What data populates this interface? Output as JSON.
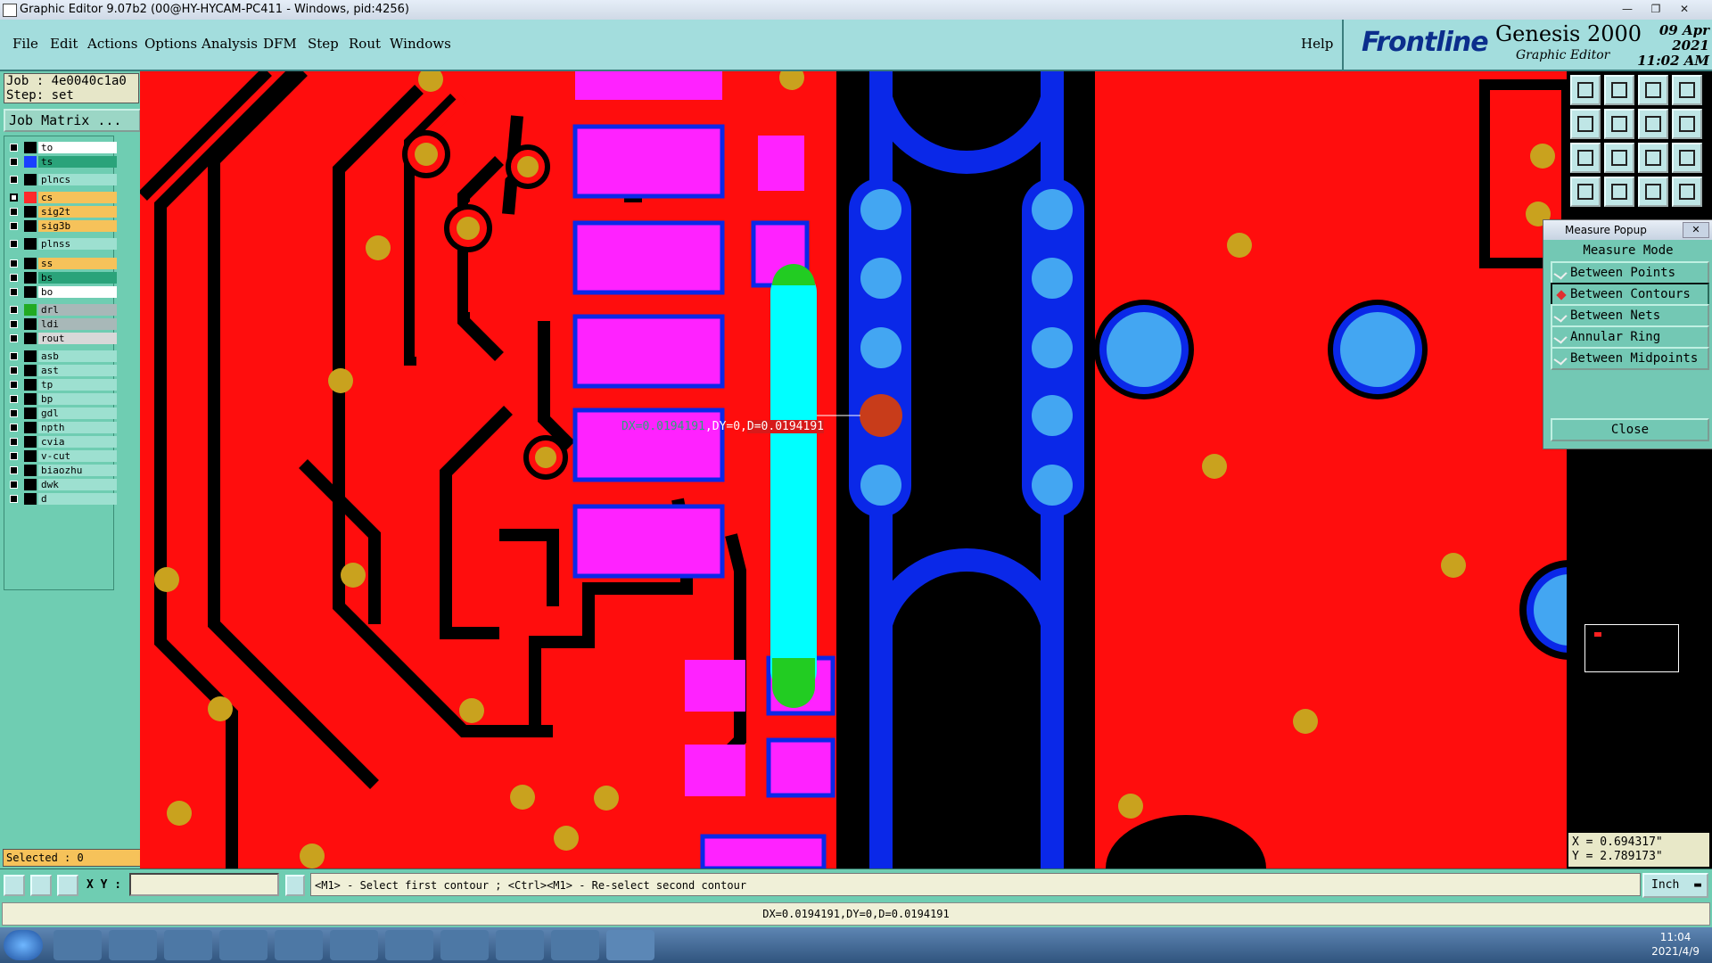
{
  "window": {
    "title": "Graphic Editor 9.07b2 (00@HY-HYCAM-PC411 - Windows, pid:4256)"
  },
  "menu": [
    {
      "label": "File"
    },
    {
      "label": "Edit"
    },
    {
      "label": "Actions"
    },
    {
      "label": "Options"
    },
    {
      "label": "Analysis"
    },
    {
      "label": "DFM"
    },
    {
      "label": "Step"
    },
    {
      "label": "Rout"
    },
    {
      "label": "Windows"
    },
    {
      "label": "Help"
    }
  ],
  "brand": {
    "logo": "Frontline",
    "product": "Genesis 2000",
    "subtitle": "Graphic Editor",
    "date": "09 Apr 2021",
    "time": "11:02 AM"
  },
  "job": {
    "job_line": "Job : 4e0040c1a0",
    "step_line": "Step: set",
    "matrix_button": "Job Matrix ..."
  },
  "layers": [
    {
      "name": "to",
      "color": "#ffffff",
      "swatch": "#000000",
      "on": false
    },
    {
      "name": "ts",
      "color": "#2aa37a",
      "swatch": "#1a3fff",
      "on": false
    },
    {
      "name": "plncs",
      "color": "#9de0d0",
      "swatch": "#000000",
      "on": false
    },
    {
      "name": "cs",
      "color": "#f6c25a",
      "swatch": "#ff2a2a",
      "on": true
    },
    {
      "name": "sig2t",
      "color": "#f6c25a",
      "swatch": "#000000",
      "on": false
    },
    {
      "name": "sig3b",
      "color": "#f6c25a",
      "swatch": "#000000",
      "on": false
    },
    {
      "name": "plnss",
      "color": "#9de0d0",
      "swatch": "#000000",
      "on": false
    },
    {
      "name": "ss",
      "color": "#f6c25a",
      "swatch": "#000000",
      "on": false
    },
    {
      "name": "bs",
      "color": "#2aa37a",
      "swatch": "#000000",
      "on": false
    },
    {
      "name": "bo",
      "color": "#ffffff",
      "swatch": "#000000",
      "on": false
    },
    {
      "name": "drl",
      "color": "#a8b8b8",
      "swatch": "#22aa22",
      "on": false
    },
    {
      "name": "ldi",
      "color": "#a8b8b8",
      "swatch": "#000000",
      "on": false
    },
    {
      "name": "rout",
      "color": "#d8d8d8",
      "swatch": "#000000",
      "on": false
    },
    {
      "name": "asb",
      "color": "#9de0d0",
      "swatch": "#000000",
      "on": false
    },
    {
      "name": "ast",
      "color": "#9de0d0",
      "swatch": "#000000",
      "on": false
    },
    {
      "name": "tp",
      "color": "#9de0d0",
      "swatch": "#000000",
      "on": false
    },
    {
      "name": "bp",
      "color": "#9de0d0",
      "swatch": "#000000",
      "on": false
    },
    {
      "name": "gdl",
      "color": "#9de0d0",
      "swatch": "#000000",
      "on": false
    },
    {
      "name": "npth",
      "color": "#9de0d0",
      "swatch": "#000000",
      "on": false
    },
    {
      "name": "cvia",
      "color": "#9de0d0",
      "swatch": "#000000",
      "on": false
    },
    {
      "name": "v-cut",
      "color": "#9de0d0",
      "swatch": "#000000",
      "on": false
    },
    {
      "name": "biaozhu",
      "color": "#9de0d0",
      "swatch": "#000000",
      "on": false
    },
    {
      "name": "dwk",
      "color": "#9de0d0",
      "swatch": "#000000",
      "on": false
    },
    {
      "name": "d",
      "color": "#9de0d0",
      "swatch": "#000000",
      "on": false
    }
  ],
  "selected": "Selected : 0",
  "measure_label": {
    "dx": "DX=0.0194191",
    "dy": ",DY=0,",
    "d": "D=0.0194191"
  },
  "popup": {
    "title": "Measure Popup",
    "heading": "Measure Mode",
    "options": [
      {
        "label": "Between Points",
        "selected": false
      },
      {
        "label": "Between Contours",
        "selected": true
      },
      {
        "label": "Between Nets",
        "selected": false
      },
      {
        "label": "Annular Ring",
        "selected": false
      },
      {
        "label": "Between Midpoints",
        "selected": false
      }
    ],
    "close": "Close"
  },
  "coords": {
    "x": "X = 0.694317\"",
    "y": "Y = 2.789173\""
  },
  "cmd": {
    "xy_label": "X Y :",
    "prompt": "<M1> - Select first contour ; <Ctrl><M1> - Re-select second contour",
    "unit": "Inch"
  },
  "status": "DX=0.0194191,DY=0,D=0.0194191",
  "taskbar": {
    "time": "11:04",
    "date": "2021/4/9"
  },
  "colors": {
    "copper": "#ff0d0d",
    "pad": "#ff22ff",
    "via_blue": "#0a28e8",
    "via_light": "#43a6f2",
    "drill": "#c9a21e",
    "trace_cyan": "#00ffff",
    "green": "#22cc22"
  },
  "icons": [
    "app-icon",
    "minimize-icon",
    "maximize-icon",
    "close-icon",
    "zoom-icon",
    "pan-icon",
    "home-icon",
    "window-icon",
    "ruler-icon",
    "help-icon",
    "start-icon",
    "checkbox-icon",
    "select-icon",
    "dropdown-icon"
  ]
}
